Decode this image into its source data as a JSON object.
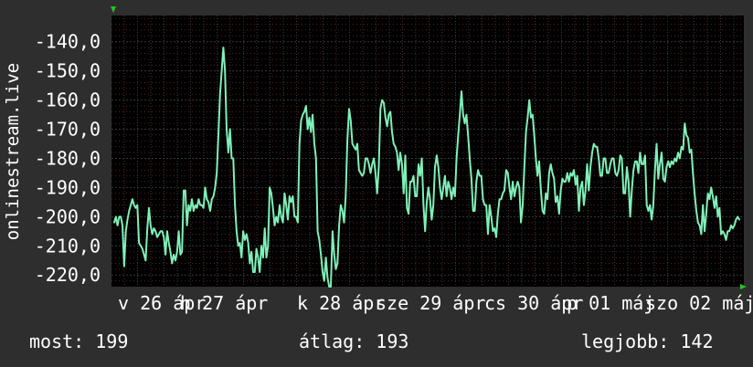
{
  "chart_data": {
    "type": "line",
    "ylabel": "onlinestream.live",
    "ylim": [
      -224,
      -131
    ],
    "y_ticks": [
      "-140,0",
      "-150,0",
      "-160,0",
      "-170,0",
      "-180,0",
      "-190,0",
      "-200,0",
      "-210,0",
      "-220,0"
    ],
    "y_tick_values": [
      -140,
      -150,
      -160,
      -170,
      -180,
      -190,
      -200,
      -210,
      -220
    ],
    "x_ticks": [
      "v 26 ápr",
      "h 27 ápr",
      "k 28 ápr",
      "sze 29 ápr",
      "cs 30 ápr",
      "p 01 máj",
      "szo 02 máj"
    ],
    "grid": true,
    "colors": {
      "background": "#2e2e2e",
      "plot_background": "#000000",
      "series": "#7ff0b8",
      "grid": "#3a3a3a",
      "minor_grid": "#5a2020",
      "axis_arrow": "#22c422",
      "text": "#ffffff"
    },
    "series": [
      {
        "values": [
          -202,
          -200,
          -203,
          -200,
          -200,
          -203,
          -217,
          -205,
          -201,
          -198,
          -196,
          -194,
          -196,
          -197,
          -196,
          -209,
          -210,
          -211,
          -213,
          -215,
          -204,
          -197,
          -203,
          -206,
          -204,
          -205,
          -207,
          -206,
          -205,
          -205,
          -207,
          -213,
          -205,
          -209,
          -212,
          -216,
          -213,
          -215,
          -212,
          -205,
          -213,
          -212,
          -191,
          -191,
          -203,
          -196,
          -198,
          -194,
          -198,
          -196,
          -197,
          -194,
          -196,
          -196,
          -197,
          -190,
          -194,
          -195,
          -198,
          -194,
          -193,
          -190,
          -185,
          -172,
          -158,
          -150,
          -142,
          -150,
          -170,
          -178,
          -170,
          -180,
          -180,
          -196,
          -205,
          -210,
          -209,
          -214,
          -205,
          -208,
          -206,
          -209,
          -216,
          -212,
          -219,
          -219,
          -211,
          -214,
          -219,
          -210,
          -214,
          -204,
          -214,
          -210,
          -190,
          -192,
          -197,
          -203,
          -200,
          -202,
          -196,
          -200,
          -202,
          -192,
          -196,
          -201,
          -193,
          -195,
          -193,
          -200,
          -200,
          -202,
          -175,
          -167,
          -165,
          -164,
          -162,
          -170,
          -166,
          -171,
          -165,
          -175,
          -180,
          -205,
          -208,
          -213,
          -219,
          -222,
          -214,
          -221,
          -224,
          -224,
          -205,
          -213,
          -218,
          -216,
          -203,
          -196,
          -198,
          -202,
          -193,
          -174,
          -163,
          -167,
          -175,
          -176,
          -177,
          -175,
          -184,
          -185,
          -186,
          -185,
          -180,
          -180,
          -182,
          -185,
          -182,
          -180,
          -185,
          -192,
          -183,
          -163,
          -160,
          -161,
          -166,
          -169,
          -165,
          -164,
          -171,
          -175,
          -176,
          -178,
          -184,
          -178,
          -182,
          -192,
          -179,
          -197,
          -199,
          -188,
          -188,
          -186,
          -193,
          -193,
          -182,
          -186,
          -180,
          -196,
          -205,
          -195,
          -190,
          -194,
          -201,
          -196,
          -183,
          -179,
          -183,
          -190,
          -194,
          -190,
          -186,
          -193,
          -188,
          -190,
          -194,
          -190,
          -193,
          -180,
          -172,
          -165,
          -157,
          -165,
          -168,
          -165,
          -172,
          -180,
          -187,
          -198,
          -198,
          -188,
          -184,
          -186,
          -186,
          -194,
          -196,
          -196,
          -206,
          -196,
          -200,
          -205,
          -204,
          -207,
          -199,
          -194,
          -194,
          -192,
          -191,
          -184,
          -185,
          -190,
          -194,
          -188,
          -193,
          -190,
          -188,
          -190,
          -202,
          -196,
          -183,
          -171,
          -166,
          -160,
          -166,
          -165,
          -172,
          -180,
          -186,
          -181,
          -191,
          -198,
          -199,
          -192,
          -194,
          -185,
          -182,
          -185,
          -187,
          -195,
          -193,
          -199,
          -191,
          -187,
          -188,
          -188,
          -185,
          -188,
          -185,
          -186,
          -184,
          -189,
          -186,
          -198,
          -190,
          -188,
          -196,
          -191,
          -182,
          -191,
          -183,
          -178,
          -175,
          -176,
          -176,
          -180,
          -186,
          -186,
          -180,
          -180,
          -185,
          -185,
          -182,
          -180,
          -180,
          -185,
          -186,
          -184,
          -179,
          -180,
          -192,
          -192,
          -183,
          -188,
          -200,
          -191,
          -184,
          -181,
          -181,
          -185,
          -178,
          -182,
          -182,
          -179,
          -196,
          -198,
          -196,
          -201,
          -196,
          -184,
          -175,
          -187,
          -182,
          -178,
          -187,
          -188,
          -183,
          -181,
          -183,
          -181,
          -182,
          -180,
          -181,
          -178,
          -180,
          -176,
          -177,
          -168,
          -172,
          -173,
          -178,
          -177,
          -185,
          -192,
          -198,
          -202,
          -203,
          -206,
          -196,
          -205,
          -199,
          -192,
          -194,
          -190,
          -193,
          -197,
          -193,
          -200,
          -197,
          -206,
          -205,
          -206,
          -208,
          -205,
          -205,
          -203,
          -204,
          -203,
          -201,
          -200,
          -201
        ]
      }
    ]
  },
  "footer": {
    "current": "most: 199",
    "average": "átlag: 193",
    "best": "legjobb: 142"
  }
}
